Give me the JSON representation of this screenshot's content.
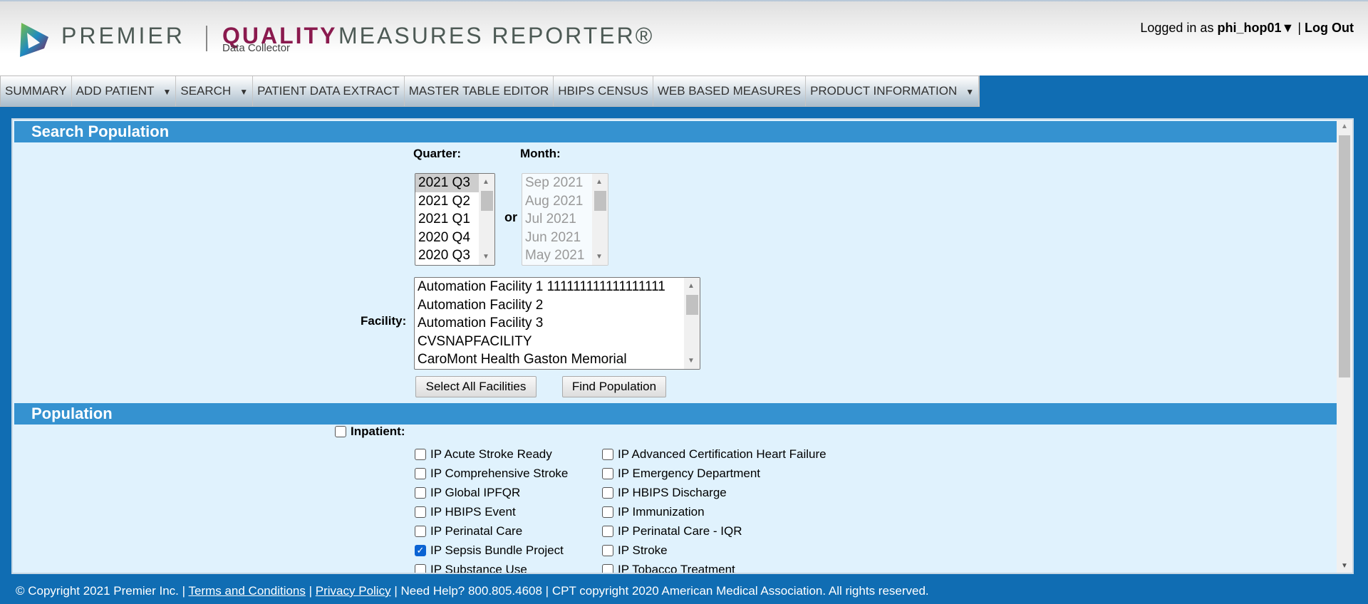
{
  "header": {
    "brand": "PREMIER",
    "product_bold": "QUALITY",
    "product_rest": "MEASURES REPORTER®",
    "subtitle": "Data Collector",
    "logged_in_prefix": "Logged in as",
    "username": "phi_hop01▼",
    "separator": "|",
    "logout": "Log Out"
  },
  "nav": [
    {
      "label": "SUMMARY",
      "caret": ""
    },
    {
      "label": "ADD PATIENT",
      "caret": "▼"
    },
    {
      "label": "SEARCH",
      "caret": "▼"
    },
    {
      "label": "PATIENT DATA EXTRACT",
      "caret": ""
    },
    {
      "label": "MASTER TABLE EDITOR",
      "caret": ""
    },
    {
      "label": "HBIPS CENSUS",
      "caret": ""
    },
    {
      "label": "WEB BASED MEASURES",
      "caret": ""
    },
    {
      "label": "PRODUCT INFORMATION",
      "caret": "▼"
    }
  ],
  "search": {
    "title": "Search Population",
    "quarter_label": "Quarter:",
    "month_label": "Month:",
    "or": "or",
    "quarters": [
      "2021 Q3",
      "2021 Q2",
      "2021 Q1",
      "2020 Q4",
      "2020 Q3"
    ],
    "selected_quarter": "2021 Q3",
    "months": [
      "Sep 2021",
      "Aug 2021",
      "Jul 2021",
      "Jun 2021",
      "May 2021"
    ],
    "facility_label": "Facility:",
    "facilities": [
      "Automation Facility 1 111111111111111111",
      "Automation Facility 2",
      "Automation Facility 3",
      "CVSNAPFACILITY",
      "CaroMont Health Gaston Memorial"
    ],
    "select_all": "Select All Facilities",
    "find": "Find Population"
  },
  "population": {
    "title": "Population",
    "inpatient_label": "Inpatient:",
    "col1": [
      {
        "label": "IP Acute Stroke Ready",
        "checked": false
      },
      {
        "label": "IP Comprehensive Stroke",
        "checked": false
      },
      {
        "label": "IP Global IPFQR",
        "checked": false
      },
      {
        "label": "IP HBIPS Event",
        "checked": false
      },
      {
        "label": "IP Perinatal Care",
        "checked": false
      },
      {
        "label": "IP Sepsis Bundle Project",
        "checked": true
      },
      {
        "label": "IP Substance Use",
        "checked": false
      }
    ],
    "col2": [
      {
        "label": "IP Advanced Certification Heart Failure",
        "checked": false
      },
      {
        "label": "IP Emergency Department",
        "checked": false
      },
      {
        "label": "IP HBIPS Discharge",
        "checked": false
      },
      {
        "label": "IP Immunization",
        "checked": false
      },
      {
        "label": "IP Perinatal Care - IQR",
        "checked": false
      },
      {
        "label": "IP Stroke",
        "checked": false
      },
      {
        "label": "IP Tobacco Treatment",
        "checked": false
      }
    ]
  },
  "footer": {
    "copyright": "© Copyright 2021 Premier Inc.  |",
    "terms": "Terms and Conditions",
    "sep": "|",
    "privacy": "Privacy Policy",
    "rest": "| Need Help? 800.805.4608 | CPT copyright 2020 American Medical Association. All rights reserved."
  },
  "colors": {
    "accent": "#106db3",
    "section": "#3592d0",
    "panel": "#e0f2fd",
    "quality": "#8a1a4e"
  }
}
